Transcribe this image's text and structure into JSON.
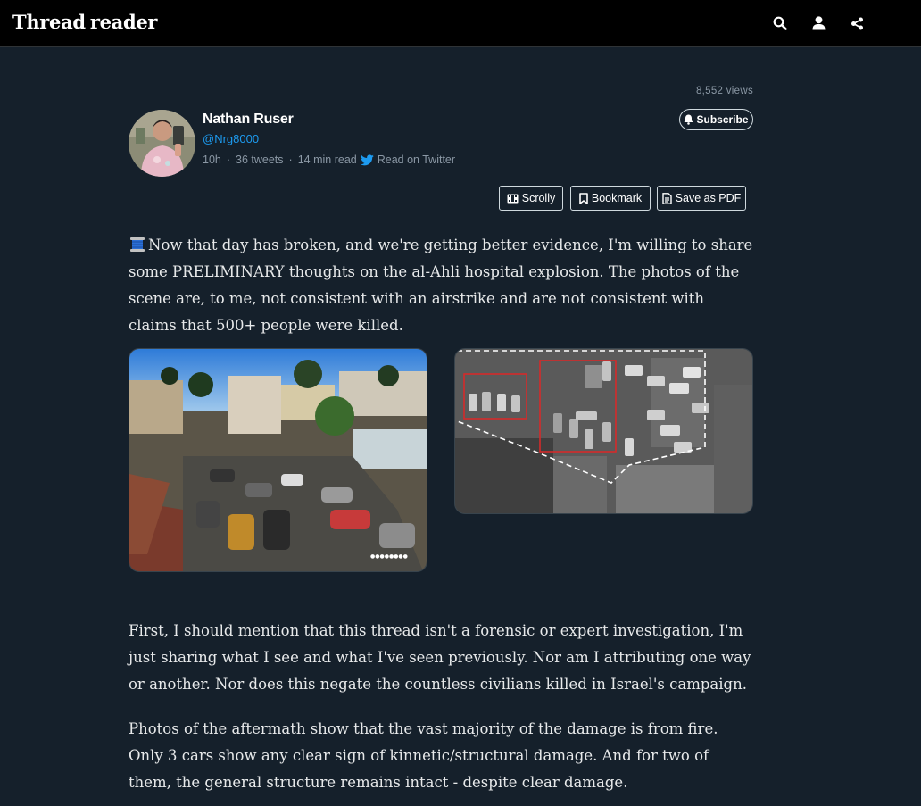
{
  "navbar": {
    "brand_part1": "Thread",
    "brand_part2": "reader",
    "icons": [
      "search-icon",
      "user-icon",
      "share-icon"
    ]
  },
  "views": "8,552 views",
  "author": {
    "name": "Nathan Ruser",
    "handle": "@Nrg8000",
    "age": "10h",
    "tweets": "36 tweets",
    "read_time": "14 min read",
    "read_on_twitter": "Read on Twitter"
  },
  "buttons": {
    "subscribe": "Subscribe",
    "scrolly": "Scrolly",
    "bookmark": "Bookmark",
    "save_pdf": "Save as PDF"
  },
  "tweets": {
    "t1": "Now that day has broken, and we're getting better evidence, I'm willing to share some PRELIMINARY thoughts on the al-Ahli hospital explosion. The photos of the scene are, to me, not consistent with an airstrike and are not consistent with claims that 500+ people were killed.",
    "t2": "First, I should mention that this thread isn't a forensic or expert investigation, I'm just sharing what I see and what I've seen previously. Nor am I attributing one way or another. Nor does this negate the countless civilians killed in Israel's campaign.",
    "t3": "Photos of the aftermath show that the vast majority of the damage is from fire. Only 3 cars show any clear sign of kinnetic/structural damage. And for two of them, the general structure remains intact - despite clear damage."
  },
  "colors": {
    "background": "#15202b",
    "navbar": "#000000",
    "link": "#1d9bf0",
    "muted": "#8b98a5",
    "highlight_box": "#d42a2a"
  }
}
